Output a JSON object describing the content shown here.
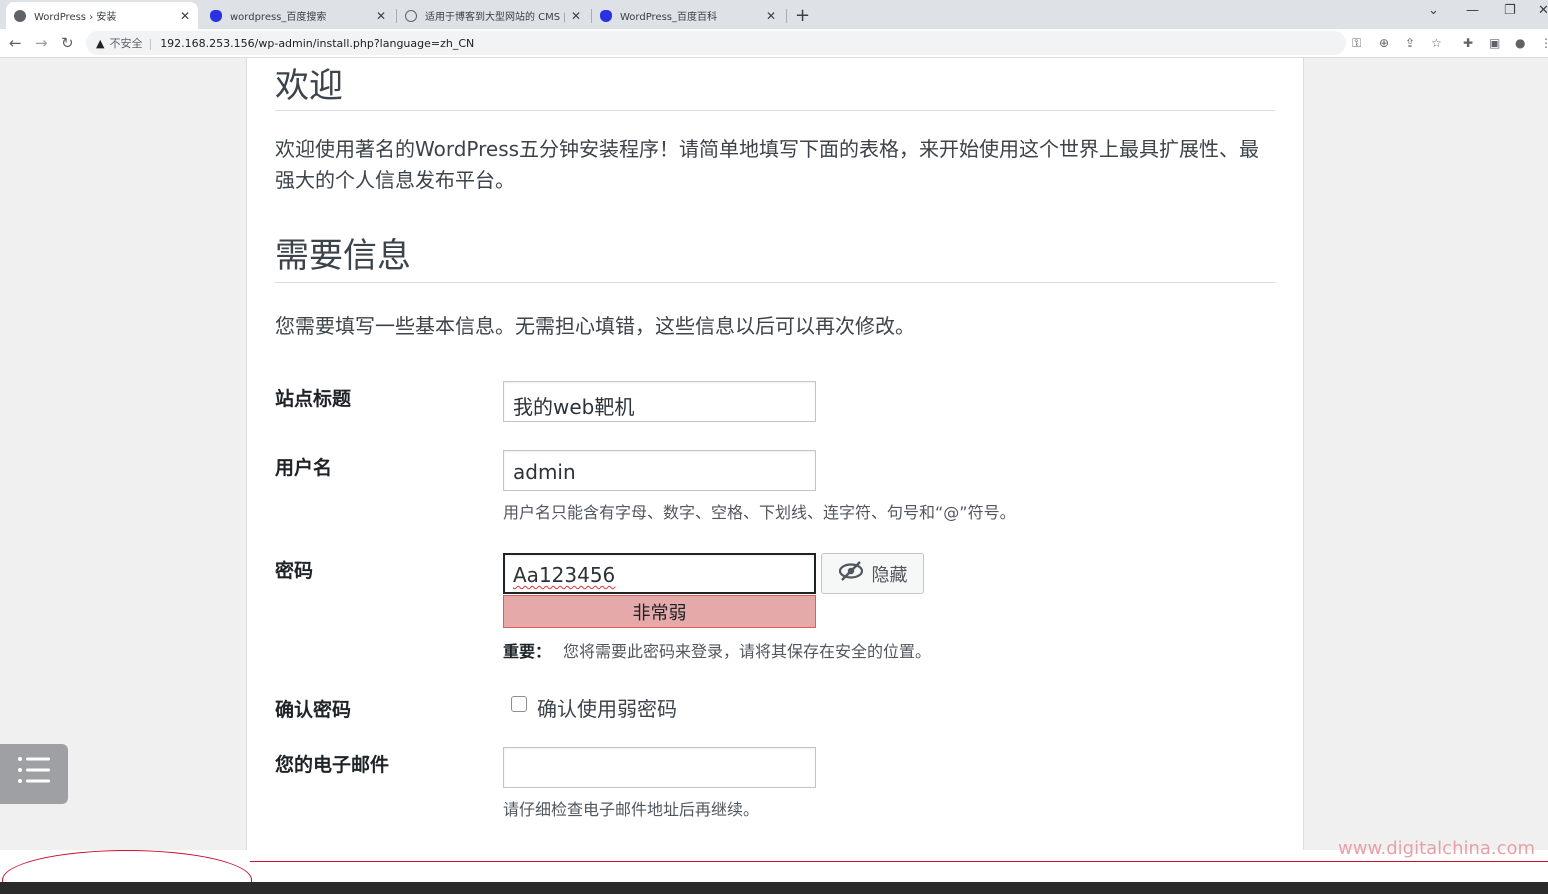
{
  "browser": {
    "tabs": [
      {
        "title": "WordPress › 安装",
        "active": true
      },
      {
        "title": "wordpress_百度搜索",
        "active": false
      },
      {
        "title": "适用于博客到大型网站的 CMS |",
        "active": false
      },
      {
        "title": "WordPress_百度百科",
        "active": false
      }
    ],
    "security_label": "不安全",
    "url": "192.168.253.156/wp-admin/install.php?language=zh_CN"
  },
  "install": {
    "welcome_heading": "欢迎",
    "welcome_text": "欢迎使用著名的WordPress五分钟安装程序！请简单地填写下面的表格，来开始使用这个世界上最具扩展性、最强大的个人信息发布平台。",
    "info_heading": "需要信息",
    "info_text": "您需要填写一些基本信息。无需担心填错，这些信息以后可以再次修改。",
    "site_title_label": "站点标题",
    "site_title_value": "我的web靶机",
    "username_label": "用户名",
    "username_value": "admin",
    "username_hint": "用户名只能含有字母、数字、空格、下划线、连字符、句号和“@”符号。",
    "password_label": "密码",
    "password_value": "Aa123456",
    "hide_button": "隐藏",
    "strength": "非常弱",
    "important_label": "重要：",
    "password_hint": "您将需要此密码来登录，请将其保存在安全的位置。",
    "confirm_label": "确认密码",
    "confirm_checkbox_label": "确认使用弱密码",
    "email_label": "您的电子邮件",
    "email_value": "",
    "email_hint": "请仔细检查电子邮件地址后再继续。"
  },
  "watermark": "www.digitalchina.com",
  "colors": {
    "strength_bg": "#e5a9a9",
    "accent_red": "#c8102e"
  }
}
